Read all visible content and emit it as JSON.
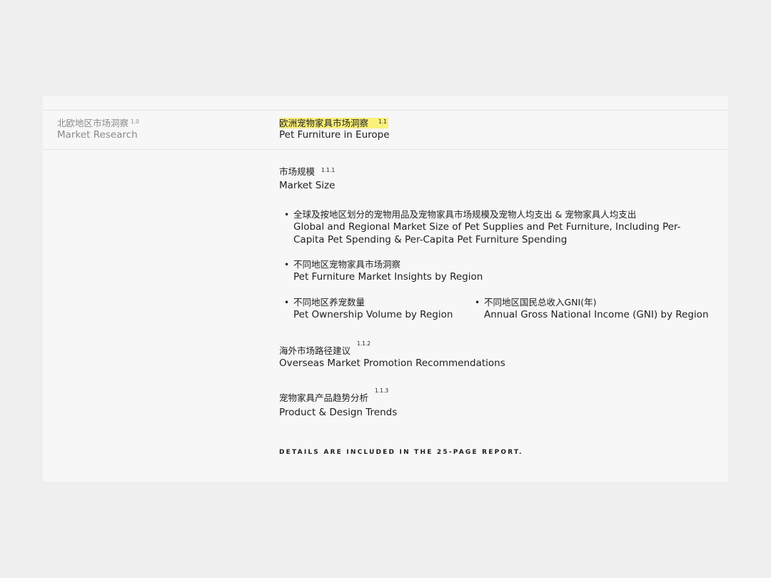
{
  "left_header": {
    "zh": "北欧地区市场洞察",
    "num": "1.0",
    "en": "Market Research"
  },
  "main_header": {
    "zh": "欧洲宠物家具市场洞察",
    "num": "1.1",
    "en": "Pet Furniture in Europe",
    "highlight_color": "#fbf07a"
  },
  "sections": [
    {
      "zh": "市场规模",
      "num": "1.1.1",
      "en": "Market Size",
      "bullets": [
        {
          "zh": "全球及按地区划分的宠物用品及宠物家具市场规模及宠物人均支出 & 宠物家具人均支出",
          "en": "Global and Regional Market Size of Pet Supplies and Pet Furniture, Including Per-Capita Pet Spending & Per-Capita Pet Furniture Spending"
        },
        {
          "zh": "不同地区宠物家具市场洞察",
          "en": "Pet Furniture Market Insights by Region"
        },
        {
          "zh": "不同地区养宠数量",
          "en": "Pet Ownership Volume by Region"
        },
        {
          "zh": "不同地区国民总收入GNI(年)",
          "en": "Annual Gross National Income (GNI) by Region"
        }
      ]
    },
    {
      "zh": "海外市场路径建议",
      "num": "1.1.2",
      "en": "Overseas Market Promotion Recommendations"
    },
    {
      "zh": "宠物家具产品趋势分析",
      "num": "1.1.3",
      "en": "Product & Design Trends"
    }
  ],
  "footer_note": "DETAILS ARE INCLUDED IN THE 25-PAGE REPORT.",
  "bullet_glyph": "•"
}
